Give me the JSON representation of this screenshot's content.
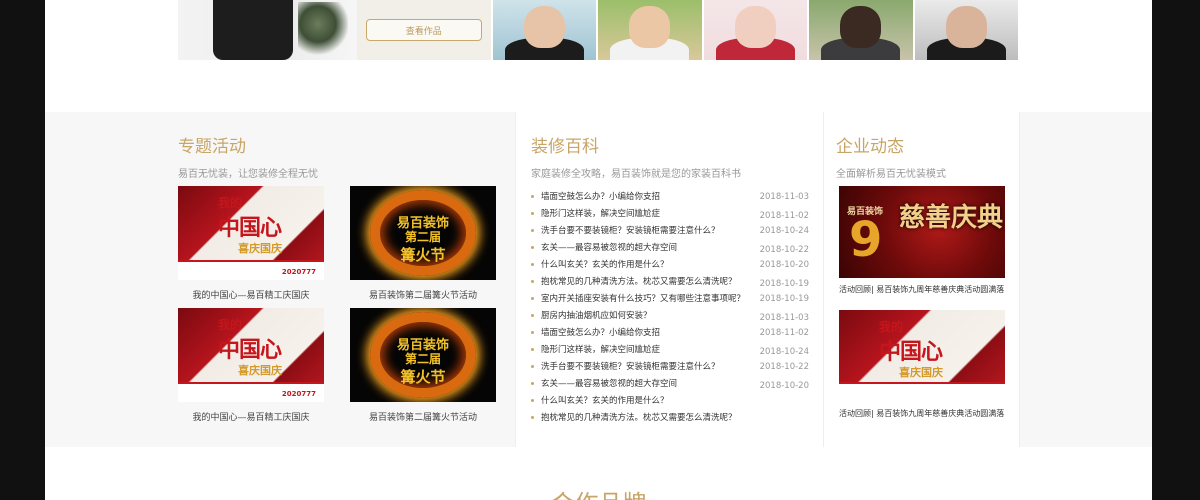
{
  "top": {
    "view_works_label": "查看作品"
  },
  "activity": {
    "title": "专题活动",
    "subtitle": "易百无忧装，让您装修全程无忧",
    "cards": [
      {
        "caption": "我的中国心—易百精工庆国庆",
        "kind": "red",
        "t1": "我的",
        "t2": "中国心",
        "t3": "喜庆国庆",
        "ph": "2020777"
      },
      {
        "caption": "易百装饰第二届篝火节活动",
        "kind": "fire",
        "f1": "易百装饰",
        "f2": "第二届",
        "f3": "篝火节"
      },
      {
        "caption": "我的中国心—易百精工庆国庆",
        "kind": "red",
        "t1": "我的",
        "t2": "中国心",
        "t3": "喜庆国庆",
        "ph": "2020777"
      },
      {
        "caption": "易百装饰第二届篝火节活动",
        "kind": "fire",
        "f1": "易百装饰",
        "f2": "第二届",
        "f3": "篝火节"
      }
    ]
  },
  "wiki": {
    "title": "装修百科",
    "subtitle": "家庭装修全攻略，易百装饰就是您的家装百科书",
    "items": [
      {
        "title": "墙面空鼓怎么办？小编给你支招",
        "date": "2018-11-03"
      },
      {
        "title": "隐形门这样装，解决空间尴尬症",
        "date": "2018-11-02"
      },
      {
        "title": "洗手台要不要装镜柜？安装镜柜需要注意什么？",
        "date": "2018-10-24"
      },
      {
        "title": "玄关——最容易被忽视的超大存空间",
        "date": "2018-10-22"
      },
      {
        "title": "什么叫玄关？玄关的作用是什么？",
        "date": "2018-10-20"
      },
      {
        "title": "抱枕常见的几种清洗方法。枕芯又需要怎么清洗呢？",
        "date": "2018-10-19"
      },
      {
        "title": "室内开关插座安装有什么技巧？又有哪些注意事项呢？",
        "date": "2018-10-19"
      },
      {
        "title": "厨房内抽油烟机应如何安装？",
        "date": "2018-11-03"
      },
      {
        "title": "墙面空鼓怎么办？小编给你支招",
        "date": "2018-11-02"
      },
      {
        "title": "隐形门这样装，解决空间尴尬症",
        "date": "2018-10-24"
      },
      {
        "title": "洗手台要不要装镜柜？安装镜柜需要注意什么？",
        "date": "2018-10-22"
      },
      {
        "title": "玄关——最容易被忽视的超大存空间",
        "date": "2018-10-20"
      },
      {
        "title": "什么叫玄关？玄关的作用是什么？",
        "date": ""
      },
      {
        "title": "抱枕常见的几种清洗方法。枕芯又需要怎么清洗呢？",
        "date": ""
      }
    ]
  },
  "news": {
    "title": "企业动态",
    "subtitle": "全面解析易百无忧装模式",
    "cards": [
      {
        "caption": "活动回顾| 易百装饰九周年慈善庆典活动圆满落",
        "kind": "anniv",
        "logo": "易百装饰",
        "nine": "9",
        "big": "慈善庆典"
      },
      {
        "caption": "活动回顾| 易百装饰九周年慈善庆典活动圆满落",
        "kind": "red",
        "t1": "我的",
        "t2": "中国心",
        "t3": "喜庆国庆"
      }
    ]
  },
  "bottom": {
    "title": "合作品牌"
  }
}
